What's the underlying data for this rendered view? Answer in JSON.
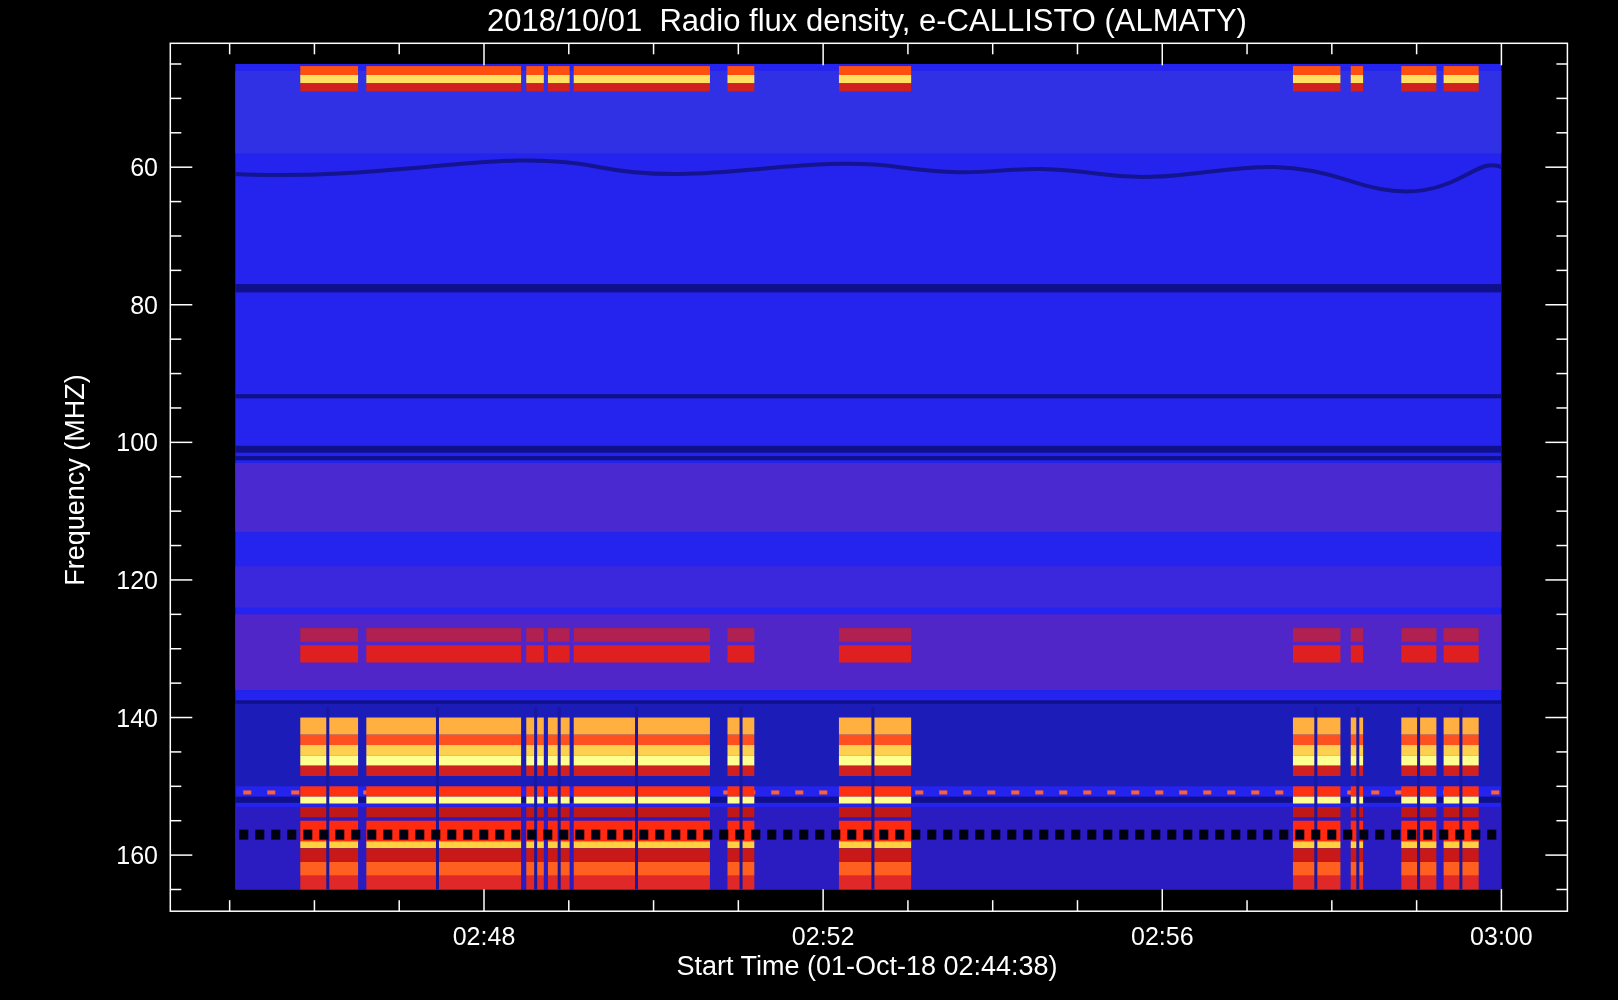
{
  "title": "2018/10/01  Radio flux density, e-CALLISTO (ALMATY)",
  "y_axis": {
    "label": "Frequency (MHZ)",
    "ticks": [
      "60",
      "80",
      "100",
      "120",
      "140",
      "160"
    ]
  },
  "x_axis": {
    "label": "Start Time (01-Oct-18 02:44:38)",
    "ticks": [
      "02:48",
      "02:52",
      "02:56",
      "03:00"
    ]
  }
}
